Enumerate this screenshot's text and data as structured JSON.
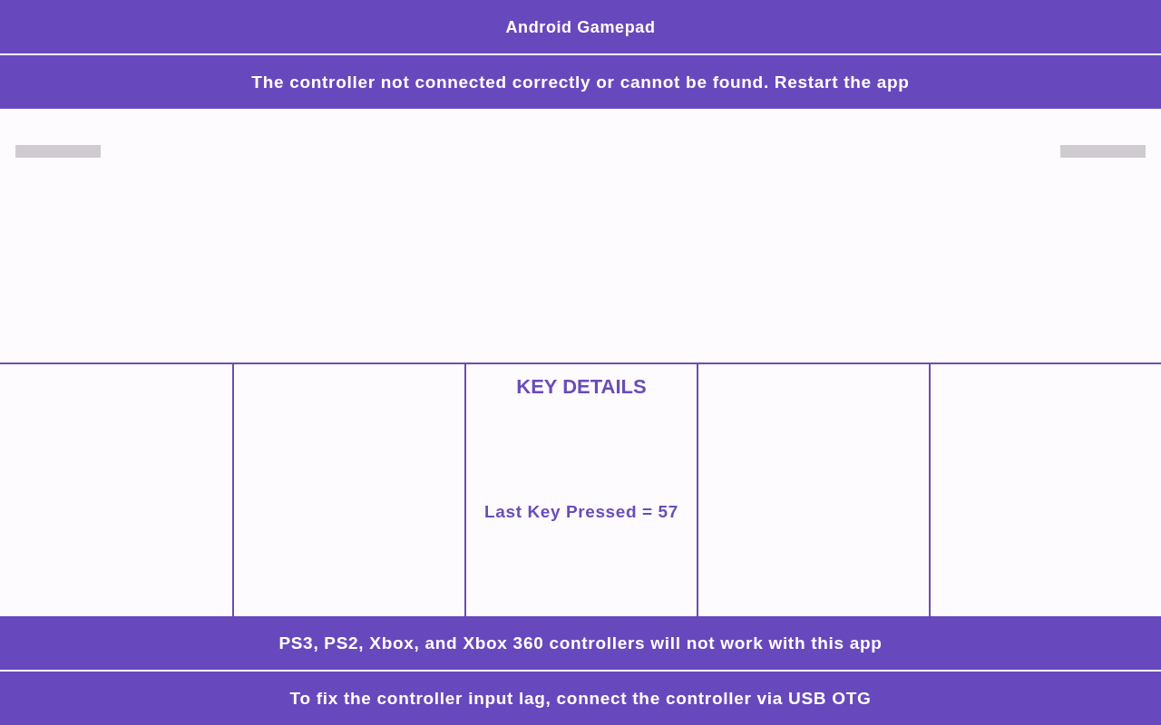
{
  "app_bar": {
    "title": "Android Gamepad"
  },
  "status_message": "The controller not connected correctly or cannot be found. Restart the app",
  "trigger_bars": [
    {
      "level": 0
    },
    {
      "level": 0
    }
  ],
  "panels": [
    {
      "kind": "empty"
    },
    {
      "kind": "empty"
    },
    {
      "kind": "key_details",
      "title": "KEY DETAILS",
      "reading": "Last Key Pressed = 57"
    },
    {
      "kind": "empty"
    },
    {
      "kind": "empty"
    }
  ],
  "notices": [
    "PS3, PS2, Xbox, and Xbox 360 controllers will not work with this app",
    "To fix the controller input lag, connect the controller via USB OTG"
  ]
}
